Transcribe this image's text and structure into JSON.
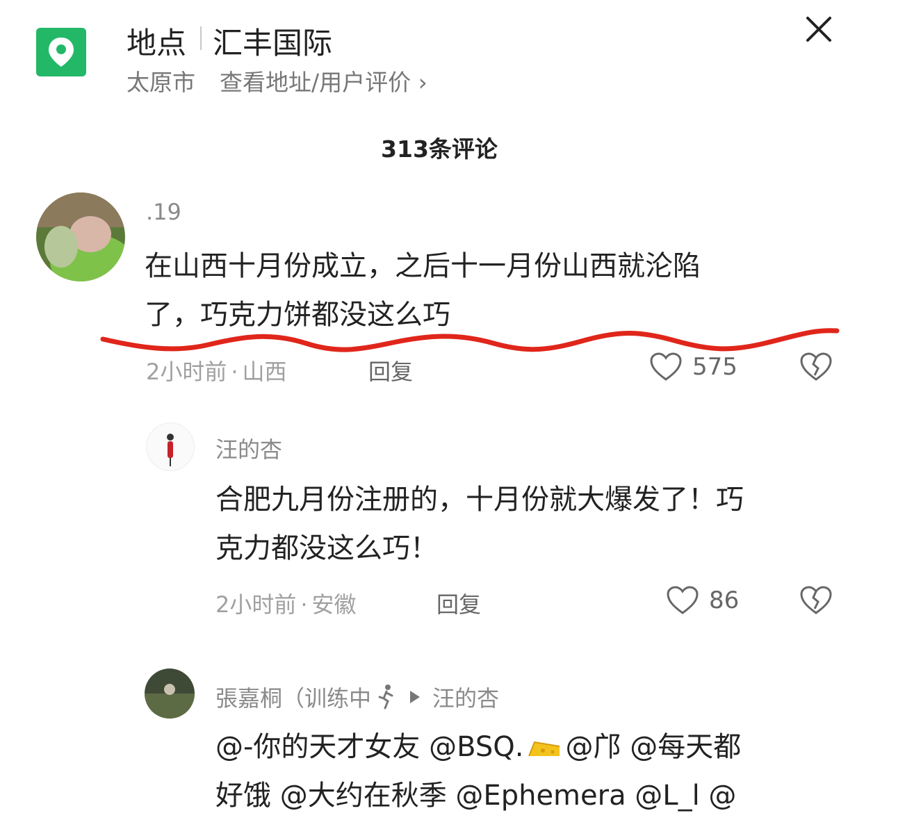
{
  "header": {
    "title": "地点",
    "place": "汇丰国际",
    "city": "太原市",
    "link": "查看地址/用户评价 ›",
    "icon": "location-pin-icon",
    "accent": "#22b868"
  },
  "comments_count": "313条评论",
  "comments": [
    {
      "user": ".19",
      "lines": [
        "在山西十月份成立，之后十一月份山西就沦陷",
        "了，巧克力饼都没这么巧"
      ],
      "time": "2小时前",
      "region": "山西",
      "reply": "回复",
      "likes": "575"
    },
    {
      "user": "汪的杏",
      "lines": [
        "合肥九月份注册的，十月份就大爆发了！巧",
        "克力都没这么巧！"
      ],
      "time": "2小时前",
      "region": "安徽",
      "reply": "回复",
      "likes": "86"
    },
    {
      "user": "張嘉桐（训练中",
      "reply_to": "汪的杏",
      "line1_a": "@-你的天才女友 @BSQ.",
      "line1_b": "@邝 @每天都",
      "line2": "好饿 @大约在秋季 @Ephemera @L_l @"
    }
  ],
  "annotation_color": "#e0261b"
}
